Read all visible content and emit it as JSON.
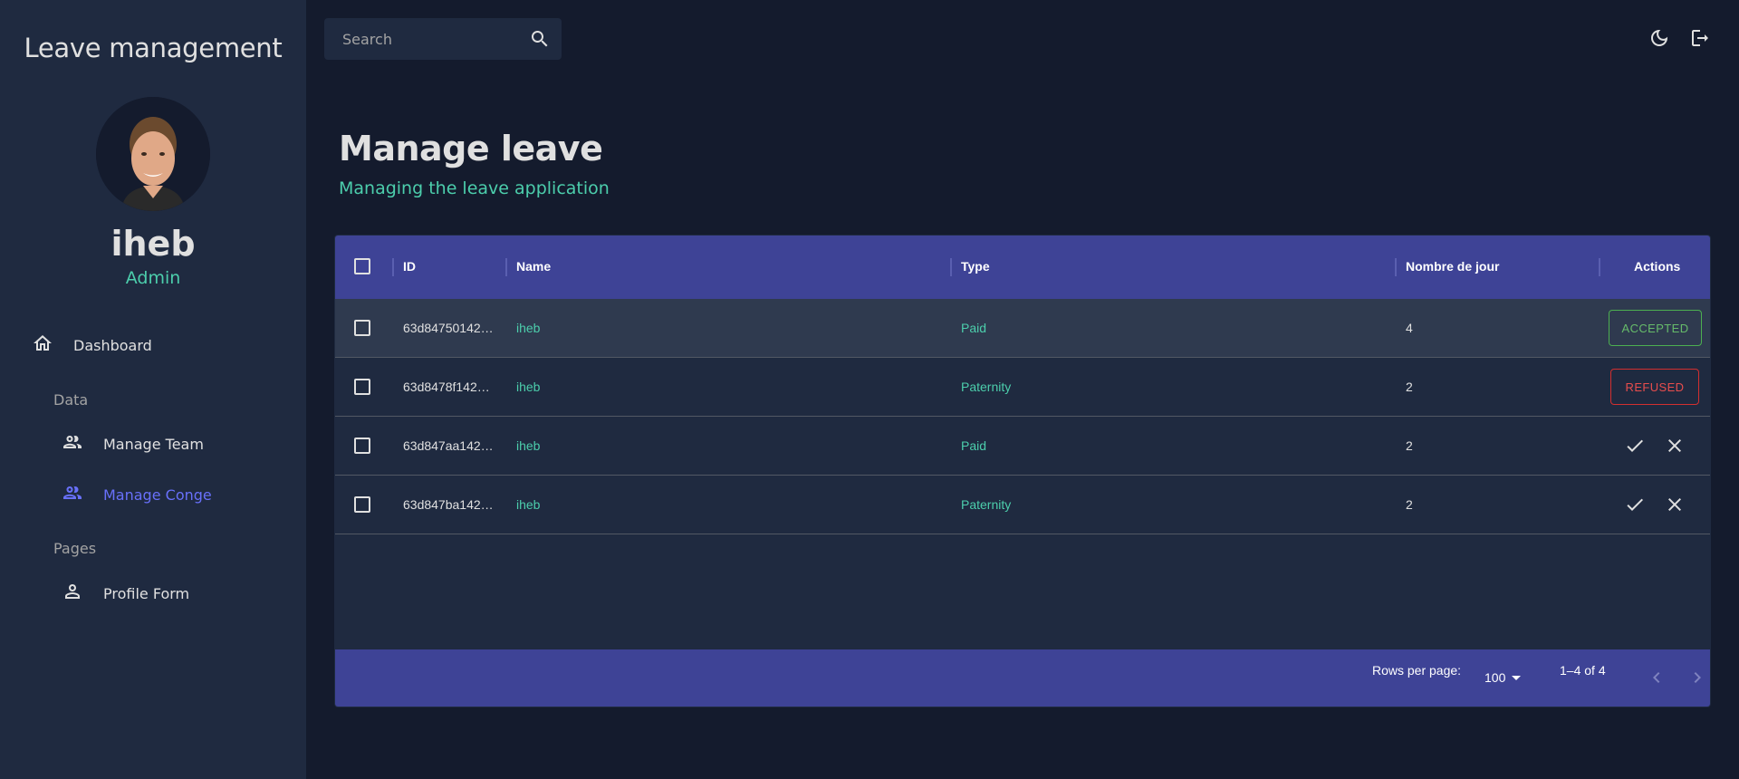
{
  "app": {
    "title": "Leave management"
  },
  "user": {
    "name": "iheb",
    "role": "Admin"
  },
  "sidebar": {
    "dashboard": "Dashboard",
    "section_data": "Data",
    "manage_team": "Manage Team",
    "manage_conge": "Manage Conge",
    "section_pages": "Pages",
    "profile_form": "Profile Form"
  },
  "topbar": {
    "search_placeholder": "Search"
  },
  "header": {
    "title": "Manage leave",
    "subtitle": "Managing the leave application"
  },
  "grid": {
    "columns": {
      "id": "ID",
      "name": "Name",
      "type": "Type",
      "days": "Nombre de jour",
      "actions": "Actions"
    },
    "rows": [
      {
        "id": "63d84750142…",
        "name": "iheb",
        "type": "Paid",
        "days": "4",
        "status": "ACCEPTED"
      },
      {
        "id": "63d8478f142…",
        "name": "iheb",
        "type": "Paternity",
        "days": "2",
        "status": "REFUSED"
      },
      {
        "id": "63d847aa142…",
        "name": "iheb",
        "type": "Paid",
        "days": "2",
        "status": ""
      },
      {
        "id": "63d847ba142…",
        "name": "iheb",
        "type": "Paternity",
        "days": "2",
        "status": ""
      }
    ],
    "footer": {
      "rows_per_page_label": "Rows per page:",
      "rows_per_page_value": "100",
      "range": "1–4 of 4"
    }
  },
  "colors": {
    "sidebar_bg": "#1f2a40",
    "page_bg": "#141b2d",
    "accent_green": "#4cceac",
    "accent_blue": "#6870fa",
    "header_bg": "#3e4396"
  }
}
